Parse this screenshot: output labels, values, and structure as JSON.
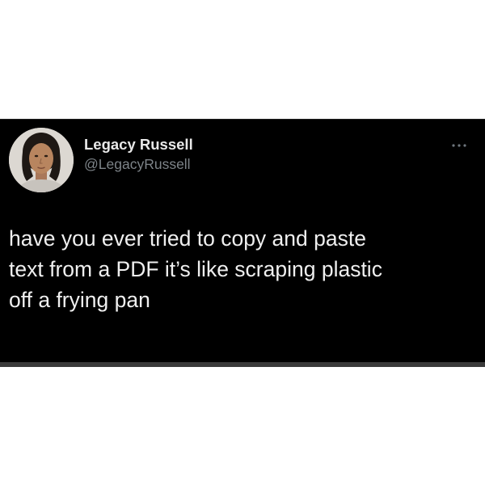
{
  "tweet": {
    "author": {
      "display_name": "Legacy Russell",
      "handle": "@LegacyRussell"
    },
    "more_icon": "more-horizontal-icon",
    "text": "have you ever tried to copy and paste\ntext from a PDF it’s like scraping plastic\noff a frying pan"
  },
  "colors": {
    "card_background": "#000000",
    "page_background": "#ffffff",
    "name_text": "#e8e8e8",
    "handle_text": "#7d8388",
    "body_text": "#efefef"
  }
}
